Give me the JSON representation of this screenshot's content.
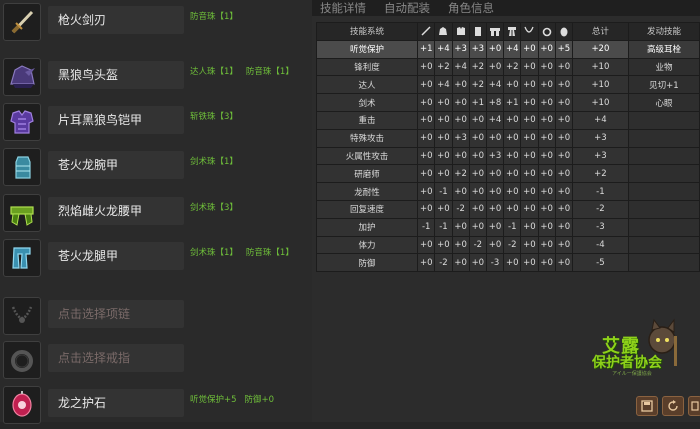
{
  "tabs": [
    {
      "label": "技能详情",
      "active": true
    },
    {
      "label": "自动配装",
      "active": false
    },
    {
      "label": "角色信息",
      "active": false
    }
  ],
  "equipment": [
    {
      "name": "枪火剑刃",
      "icon": "sword-icon",
      "decorations": [
        "防音珠【1】"
      ],
      "empty": false
    },
    {
      "name": "黑狼鸟头盔",
      "icon": "helmet-icon",
      "decorations": [
        "达人珠【1】",
        "防音珠【1】"
      ],
      "empty": false
    },
    {
      "name": "片耳黑狼鸟铠甲",
      "icon": "chest-armor-icon",
      "decorations": [
        "斩铁珠【3】"
      ],
      "empty": false
    },
    {
      "name": "苍火龙腕甲",
      "icon": "gauntlet-icon",
      "decorations": [
        "剑术珠【1】"
      ],
      "empty": false
    },
    {
      "name": "烈焰雌火龙腰甲",
      "icon": "waist-armor-icon",
      "decorations": [
        "剑术珠【3】"
      ],
      "empty": false
    },
    {
      "name": "苍火龙腿甲",
      "icon": "leg-armor-icon",
      "decorations": [
        "剑术珠【1】",
        "防音珠【1】"
      ],
      "empty": false
    },
    {
      "name": "点击选择项链",
      "icon": "necklace-icon",
      "decorations": [],
      "empty": true
    },
    {
      "name": "点击选择戒指",
      "icon": "ring-icon",
      "decorations": [],
      "empty": true
    },
    {
      "name": "龙之护石",
      "icon": "charm-icon",
      "decorations": [
        "听觉保护+5",
        "防御+0"
      ],
      "empty": false
    }
  ],
  "table": {
    "header_skill": "技能系统",
    "header_total": "总计",
    "header_active": "发动技能",
    "column_icons": [
      "sword-col-icon",
      "helmet-col-icon",
      "chest-col-icon",
      "arm-col-icon",
      "waist-col-icon",
      "leg-col-icon",
      "necklace-col-icon",
      "ring-col-icon",
      "charm-col-icon"
    ],
    "rows": [
      {
        "skill": "听觉保护",
        "values": [
          "+1",
          "+4",
          "+3",
          "+3",
          "+0",
          "+4",
          "+0",
          "+0",
          "+5"
        ],
        "total": "+20",
        "active": "高级耳栓",
        "highlight": true
      },
      {
        "skill": "锋利度",
        "values": [
          "+0",
          "+2",
          "+4",
          "+2",
          "+0",
          "+2",
          "+0",
          "+0",
          "+0"
        ],
        "total": "+10",
        "active": "业物"
      },
      {
        "skill": "达人",
        "values": [
          "+0",
          "+4",
          "+0",
          "+2",
          "+4",
          "+0",
          "+0",
          "+0",
          "+0"
        ],
        "total": "+10",
        "active": "见切+1"
      },
      {
        "skill": "剑术",
        "values": [
          "+0",
          "+0",
          "+0",
          "+1",
          "+8",
          "+1",
          "+0",
          "+0",
          "+0"
        ],
        "total": "+10",
        "active": "心眼"
      },
      {
        "skill": "重击",
        "values": [
          "+0",
          "+0",
          "+0",
          "+0",
          "+4",
          "+0",
          "+0",
          "+0",
          "+0"
        ],
        "total": "+4",
        "active": ""
      },
      {
        "skill": "特殊攻击",
        "values": [
          "+0",
          "+0",
          "+3",
          "+0",
          "+0",
          "+0",
          "+0",
          "+0",
          "+0"
        ],
        "total": "+3",
        "active": ""
      },
      {
        "skill": "火属性攻击",
        "values": [
          "+0",
          "+0",
          "+0",
          "+0",
          "+3",
          "+0",
          "+0",
          "+0",
          "+0"
        ],
        "total": "+3",
        "active": ""
      },
      {
        "skill": "研磨师",
        "values": [
          "+0",
          "+0",
          "+2",
          "+0",
          "+0",
          "+0",
          "+0",
          "+0",
          "+0"
        ],
        "total": "+2",
        "active": ""
      },
      {
        "skill": "龙耐性",
        "values": [
          "+0",
          "-1",
          "+0",
          "+0",
          "+0",
          "+0",
          "+0",
          "+0",
          "+0"
        ],
        "total": "-1",
        "active": ""
      },
      {
        "skill": "回复速度",
        "values": [
          "+0",
          "+0",
          "-2",
          "+0",
          "+0",
          "+0",
          "+0",
          "+0",
          "+0"
        ],
        "total": "-2",
        "active": ""
      },
      {
        "skill": "加护",
        "values": [
          "-1",
          "-1",
          "+0",
          "+0",
          "+0",
          "-1",
          "+0",
          "+0",
          "+0"
        ],
        "total": "-3",
        "active": ""
      },
      {
        "skill": "体力",
        "values": [
          "+0",
          "+0",
          "+0",
          "-2",
          "+0",
          "-2",
          "+0",
          "+0",
          "+0"
        ],
        "total": "-4",
        "active": ""
      },
      {
        "skill": "防御",
        "values": [
          "+0",
          "-2",
          "+0",
          "+0",
          "-3",
          "+0",
          "+0",
          "+0",
          "+0"
        ],
        "total": "-5",
        "active": ""
      }
    ]
  },
  "logo": {
    "line1": "艾露",
    "line2": "保护者协会",
    "sub": "アイルー保護協会"
  },
  "colors": {
    "decoration_text": "#6fbf3a",
    "empty_slot_text": "#7a6a68",
    "highlight_row": "#4b4b4b",
    "logo_green": "#8ed11a"
  }
}
